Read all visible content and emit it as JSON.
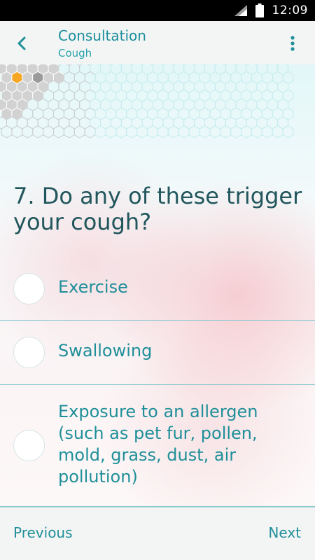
{
  "status_bar": {
    "time": "12:09",
    "icons": [
      "signal-icon",
      "battery-icon"
    ]
  },
  "app_bar": {
    "title": "Consultation",
    "subtitle": "Cough",
    "back_icon": "chevron-left-icon",
    "menu_icon": "more-vert-icon"
  },
  "progress": {
    "icon": "hexagon-progress-grid",
    "colors": {
      "current": "#f5a623",
      "visited": "#9a9a9a",
      "done": "#d2d2d2",
      "todo": "#c6ecee"
    }
  },
  "question": {
    "text": "7. Do any of these trigger your cough?"
  },
  "options": [
    {
      "label": "Exercise"
    },
    {
      "label": "Swallowing"
    },
    {
      "label": "Exposure to an allergen (such as pet fur, pollen, mold, grass, dust, air pollution)"
    }
  ],
  "footer": {
    "previous_label": "Previous",
    "next_label": "Next"
  },
  "colors": {
    "accent": "#1f8f99",
    "question_text": "#20565c",
    "status_bar": "#000000",
    "app_bar": "#f3f4f4"
  }
}
